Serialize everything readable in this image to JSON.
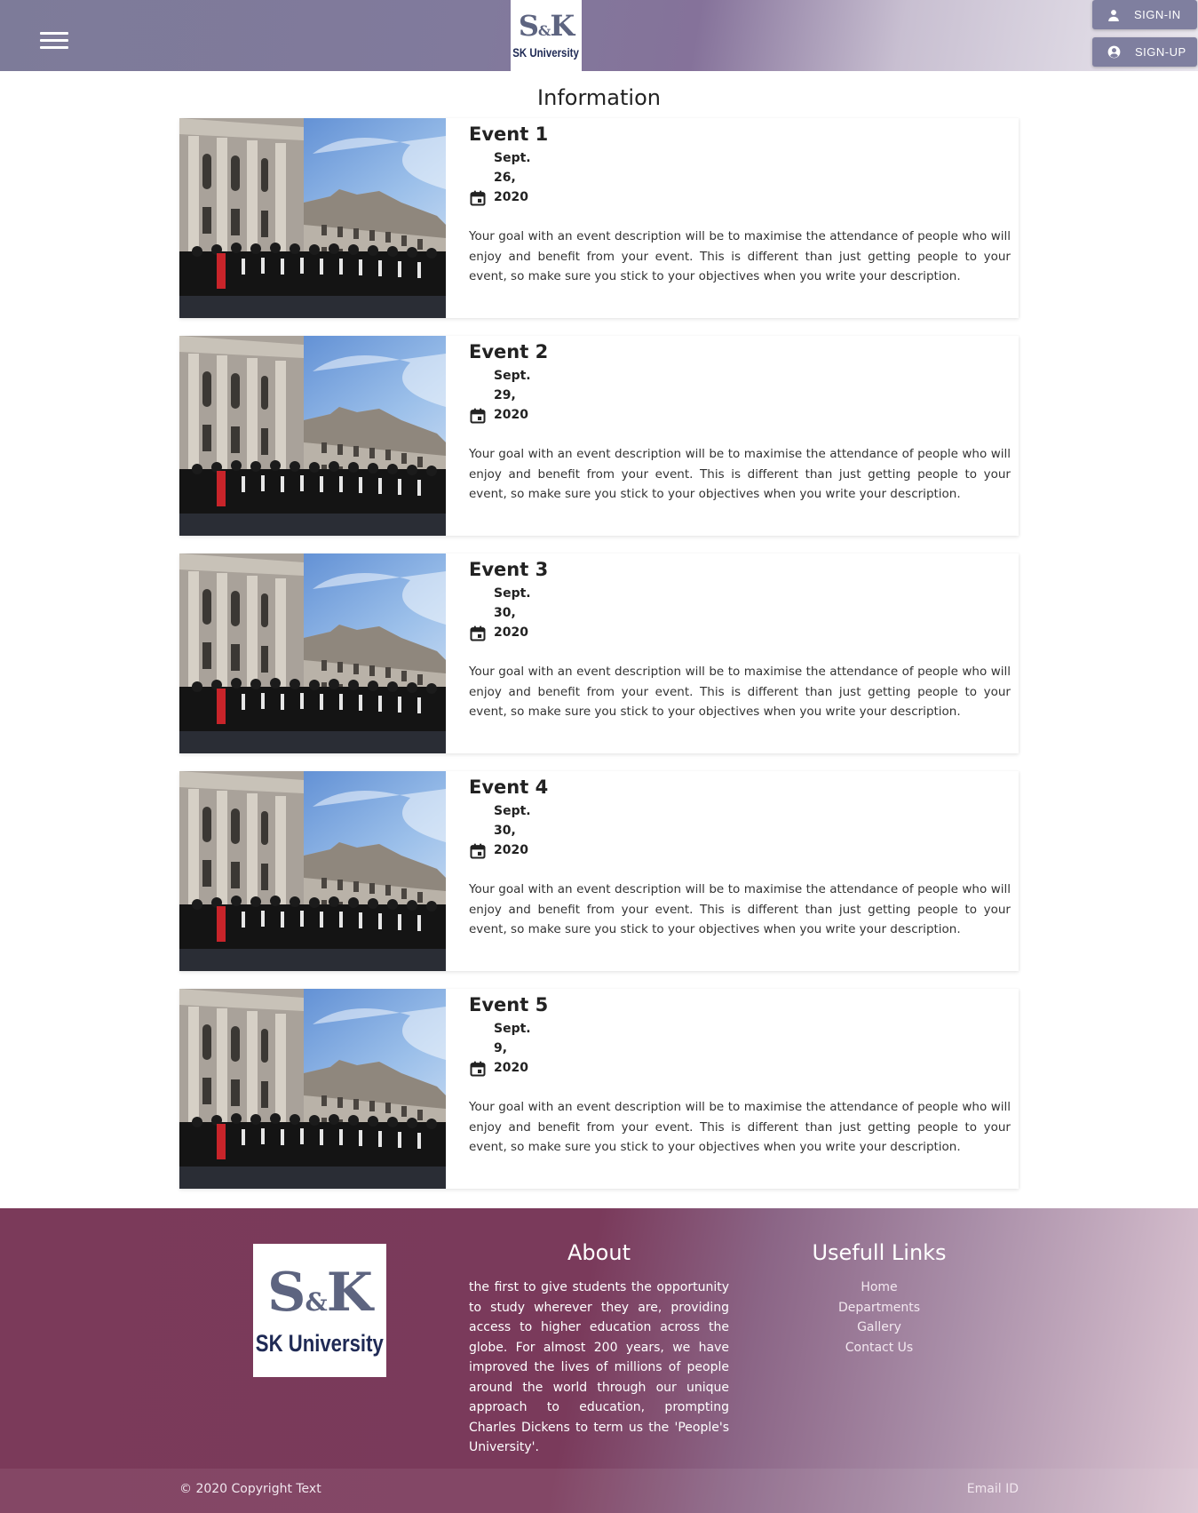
{
  "header": {
    "logo_text_top": "S&K",
    "logo_text_bottom": "SK University",
    "signin_label": "SIGN-IN",
    "signup_label": "SIGN-UP"
  },
  "page": {
    "title": "Information"
  },
  "events": [
    {
      "title": "Event 1",
      "month": "Sept.",
      "day": "26,",
      "year": "2020",
      "description": "Your goal with an event description will be to maximise the attendance of people who will enjoy and benefit from your event. This is different than just getting people to your event, so make sure you stick to your objectives when you write your description."
    },
    {
      "title": "Event 2",
      "month": "Sept.",
      "day": "29,",
      "year": "2020",
      "description": "Your goal with an event description will be to maximise the attendance of people who will enjoy and benefit from your event. This is different than just getting people to your event, so make sure you stick to your objectives when you write your description."
    },
    {
      "title": "Event 3",
      "month": "Sept.",
      "day": "30,",
      "year": "2020",
      "description": "Your goal with an event description will be to maximise the attendance of people who will enjoy and benefit from your event. This is different than just getting people to your event, so make sure you stick to your objectives when you write your description."
    },
    {
      "title": "Event 4",
      "month": "Sept.",
      "day": "30,",
      "year": "2020",
      "description": "Your goal with an event description will be to maximise the attendance of people who will enjoy and benefit from your event. This is different than just getting people to your event, so make sure you stick to your objectives when you write your description."
    },
    {
      "title": "Event 5",
      "month": "Sept.",
      "day": "9,",
      "year": "2020",
      "description": "Your goal with an event description will be to maximise the attendance of people who will enjoy and benefit from your event. This is different than just getting people to your event, so make sure you stick to your objectives when you write your description."
    }
  ],
  "footer": {
    "about_title": "About",
    "about_text": "the first to give students the opportunity to study wherever they are, providing access to higher education across the globe. For almost 200 years, we have improved the lives of millions of people around the world through our unique approach to education, prompting Charles Dickens to term us the 'People's University'.",
    "links_title": "Usefull Links",
    "links": [
      "Home",
      "Departments",
      "Gallery",
      "Contact Us"
    ],
    "copyright": "© 2020 Copyright Text",
    "email": "Email ID"
  },
  "icons": {
    "menu": "hamburger-menu-icon",
    "signin": "person-icon",
    "signup": "account-circle-icon",
    "date": "calendar-icon"
  },
  "colors": {
    "header_start": "#7d7b99",
    "footer_base": "#7b3a5a",
    "button": "#7f7f9f",
    "logo_text": "#5d6480",
    "logo_university": "#1f2a55"
  }
}
